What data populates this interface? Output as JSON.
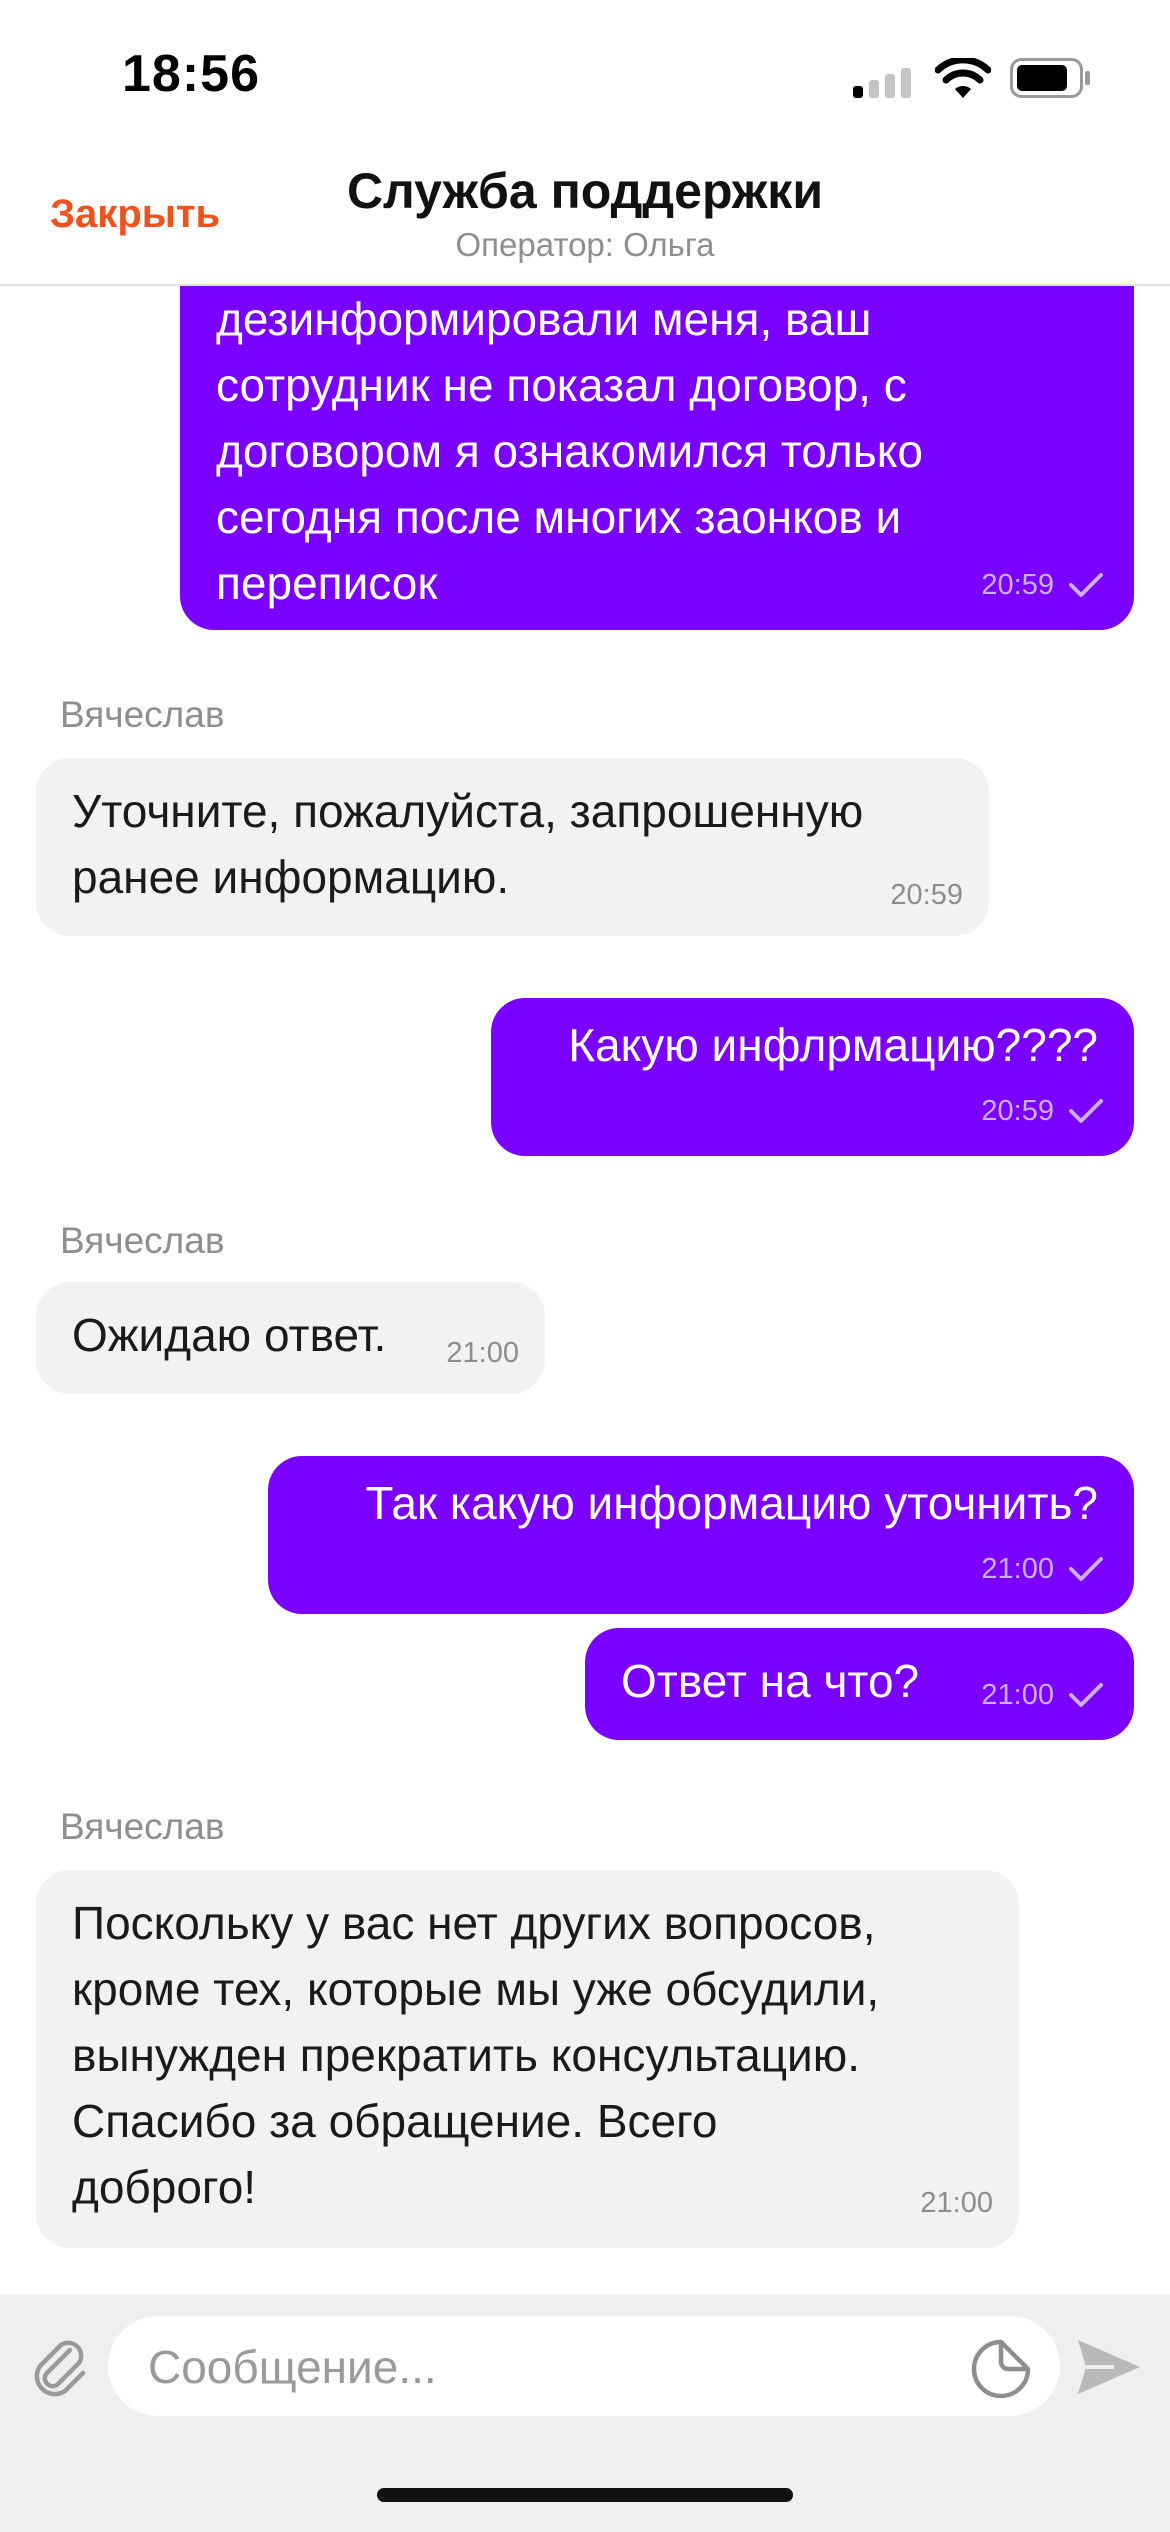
{
  "status_bar": {
    "time": "18:56"
  },
  "header": {
    "close_label": "Закрыть",
    "title": "Служба поддержки",
    "subtitle": "Оператор: Ольга"
  },
  "messages": [
    {
      "direction": "outgoing",
      "text": "дезинформировали меня, ваш\nсотрудник не показал договор, с\nдоговором я ознакомился только\nсегодня после многих заонков и\nпереписок",
      "time": "20:59"
    },
    {
      "direction": "incoming",
      "sender": "Вячеслав",
      "text": "Уточните, пожалуйста, запрошенную\nранее информацию.",
      "time": "20:59"
    },
    {
      "direction": "outgoing",
      "text": "Какую инфлрмацию????",
      "time": "20:59"
    },
    {
      "direction": "incoming",
      "sender": "Вячеслав",
      "text": "Ожидаю ответ.",
      "time": "21:00"
    },
    {
      "direction": "outgoing",
      "text": "Так какую информацию уточнить?",
      "time": "21:00"
    },
    {
      "direction": "outgoing",
      "text": "Ответ на что?",
      "time": "21:00"
    },
    {
      "direction": "incoming",
      "sender": "Вячеслав",
      "text": "Поскольку у вас нет других вопросов,\nкроме тех, которые мы уже обсудили,\nвынужден прекратить консультацию.\nСпасибо за обращение. Всего\nдоброго!",
      "time": "21:00"
    }
  ],
  "input": {
    "placeholder": "Сообщение...",
    "value": ""
  },
  "icons": {
    "attach": "paperclip-icon",
    "sticker": "sticker-icon",
    "send": "send-icon",
    "delivered": "checkmark-icon"
  },
  "colors": {
    "accent": "#f0521e",
    "outgoing_bubble": "#7a00ff",
    "incoming_bubble": "#f2f2f2"
  }
}
